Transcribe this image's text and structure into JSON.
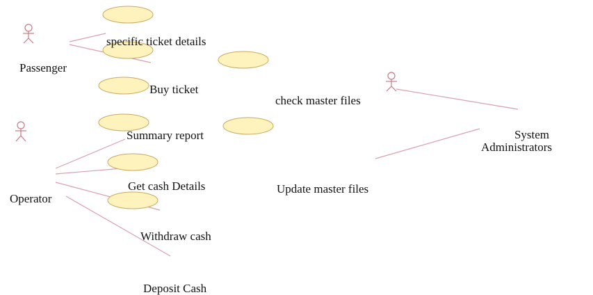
{
  "colors": {
    "usecase_fill": "#fff3bd",
    "usecase_stroke": "#c9a95f",
    "line": "#d9a0ac",
    "actor": "#c97a86",
    "text": "#111111"
  },
  "actors": [
    {
      "name": "Passenger"
    },
    {
      "name": "Operator"
    },
    {
      "name": "System Administrators",
      "lines": [
        "System",
        "Administrators"
      ]
    }
  ],
  "use_cases": [
    "specific ticket details",
    "Buy ticket",
    "check master files",
    "Summary report",
    "Get cash Details",
    "Update master files",
    "Withdraw cash",
    "Deposit Cash"
  ]
}
